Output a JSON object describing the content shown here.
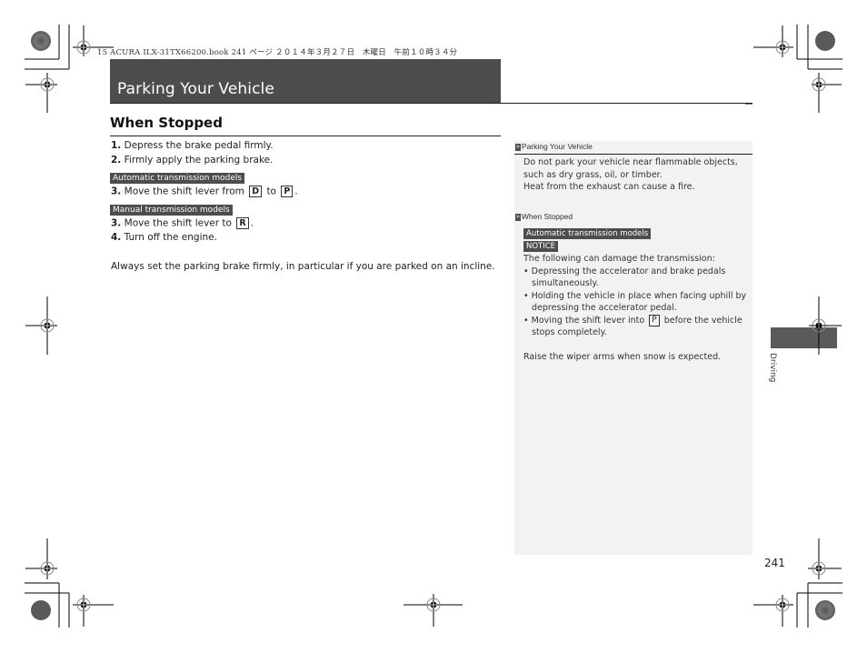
{
  "print_header": "15 ACURA ILX-31TX66200.book  241 ページ  ２０１４年３月２７日　木曜日　午前１０時３４分",
  "page": {
    "title": "Parking Your Vehicle",
    "section_title": "When Stopped",
    "steps": [
      {
        "num": "1.",
        "text": "Depress the brake pedal firmly."
      },
      {
        "num": "2.",
        "text": "Firmly apply the parking brake."
      }
    ],
    "automatic": {
      "tag": "Automatic transmission models",
      "step_num": "3.",
      "step_text_before": "Move the shift lever from",
      "key1": "D",
      "step_text_mid": "to",
      "key2": "P",
      "step_text_after": "."
    },
    "manual": {
      "tag": "Manual transmission models",
      "step_num": "3.",
      "step_text_before": "Move the shift lever to",
      "key1": "R",
      "step_text_after": "."
    },
    "step4": {
      "num": "4.",
      "text": "Turn off the engine."
    },
    "note": "Always set the parking brake firmly, in particular if you are parked on an incline."
  },
  "sidebar": {
    "ref_marker": "»",
    "block1": {
      "ref": "Parking Your Vehicle",
      "lines": [
        "Do not park your vehicle near flammable objects,",
        "such as dry grass, oil, or timber.",
        "Heat from the exhaust can cause a fire."
      ]
    },
    "block2": {
      "ref": "When Stopped",
      "tag": "Automatic transmission models",
      "notice": "NOTICE",
      "intro": "The following can damage the transmission:",
      "bullets": [
        {
          "line1": "Depressing the accelerator and brake pedals",
          "line2": "simultaneously."
        },
        {
          "line1": "Holding the vehicle in place when facing uphill by",
          "line2": "depressing the accelerator pedal."
        },
        {
          "line1_before": "Moving the shift lever into",
          "key": "P",
          "line1_after": "before the vehicle",
          "line2": "stops completely."
        }
      ],
      "footer": "Raise the wiper arms when snow is expected."
    }
  },
  "chapter_tab": "Driving",
  "page_number": "241",
  "colors": {
    "title_bar": "#4d4d4d",
    "tag_bg": "#4d4d4d",
    "sidebar_bg": "#f2f2f2",
    "tab_bg": "#5a5a5a"
  }
}
